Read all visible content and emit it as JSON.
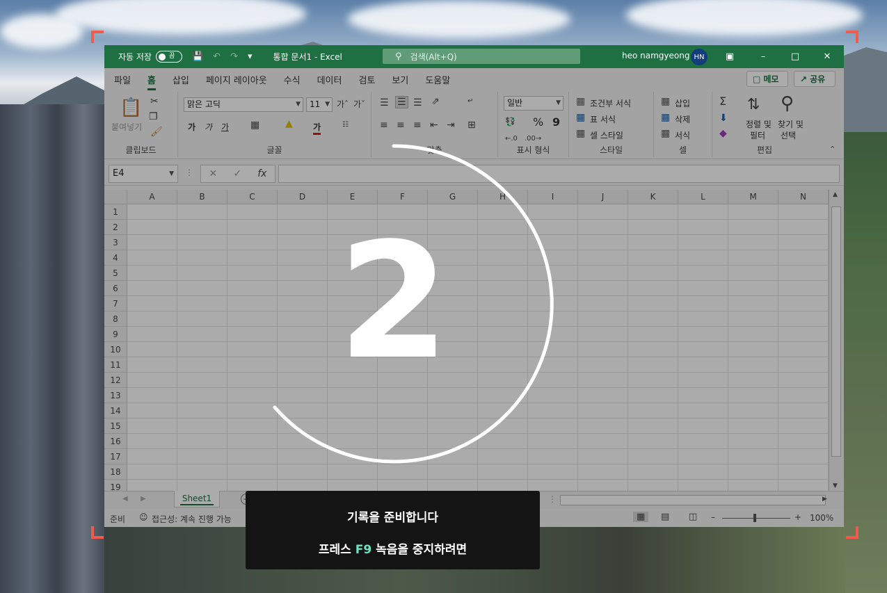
{
  "titlebar": {
    "autosave_label": "자동 저장",
    "autosave_state": "끔",
    "doc_title": "통합 문서1  -  Excel",
    "search_placeholder": "검색(Alt+Q)",
    "user_name": "heo namgyeong",
    "user_initials": "HN"
  },
  "tabs": [
    "파일",
    "홈",
    "삽입",
    "페이지 레이아웃",
    "수식",
    "데이터",
    "검토",
    "보기",
    "도움말"
  ],
  "active_tab": "홈",
  "actions": {
    "memo": "메모",
    "share": "공유"
  },
  "ribbon": {
    "clipboard": {
      "label": "클립보드",
      "paste": "붙여넣기"
    },
    "font": {
      "label": "글꼴",
      "font_name": "맑은 고딕",
      "font_size": "11",
      "bold": "가",
      "italic": "가",
      "underline": "가",
      "color_glyph": "가"
    },
    "alignment": {
      "label": "맞춤",
      "wrap": "자동"
    },
    "number": {
      "label": "표시 형식",
      "format": "일반",
      "percent": "%",
      "comma": "9"
    },
    "styles": {
      "label": "스타일",
      "conditional": "조건부 서식",
      "table": "표 서식",
      "cell_styles": "셀 스타일"
    },
    "cells": {
      "label": "셀",
      "insert": "삽입",
      "delete": "삭제",
      "format": "서식"
    },
    "editing": {
      "label": "편집",
      "sort_filter_1": "정렬 및",
      "sort_filter_2": "필터",
      "find_select_1": "찾기 및",
      "find_select_2": "선택"
    }
  },
  "formula_bar": {
    "name_box": "E4",
    "fx": "fx"
  },
  "columns": [
    "A",
    "B",
    "C",
    "D",
    "E",
    "F",
    "G",
    "H",
    "I",
    "J",
    "K",
    "L",
    "M",
    "N"
  ],
  "rows": [
    "1",
    "2",
    "3",
    "4",
    "5",
    "6",
    "7",
    "8",
    "9",
    "10",
    "11",
    "12",
    "13",
    "14",
    "15",
    "16",
    "17",
    "18",
    "19"
  ],
  "sheets": [
    "Sheet1"
  ],
  "status": {
    "ready": "준비",
    "accessibility": "접근성: 계속 진행 가능",
    "zoom": "100%"
  },
  "overlay": {
    "countdown": "2",
    "message_line1": "기록을 준비합니다",
    "message_prefix": "프레스",
    "message_key": "F9",
    "message_suffix": "녹음을 중지하려면"
  },
  "colors": {
    "excel_green": "#1e6f42",
    "bracket": "#f25b4b",
    "key_highlight": "#6fe3c1"
  }
}
